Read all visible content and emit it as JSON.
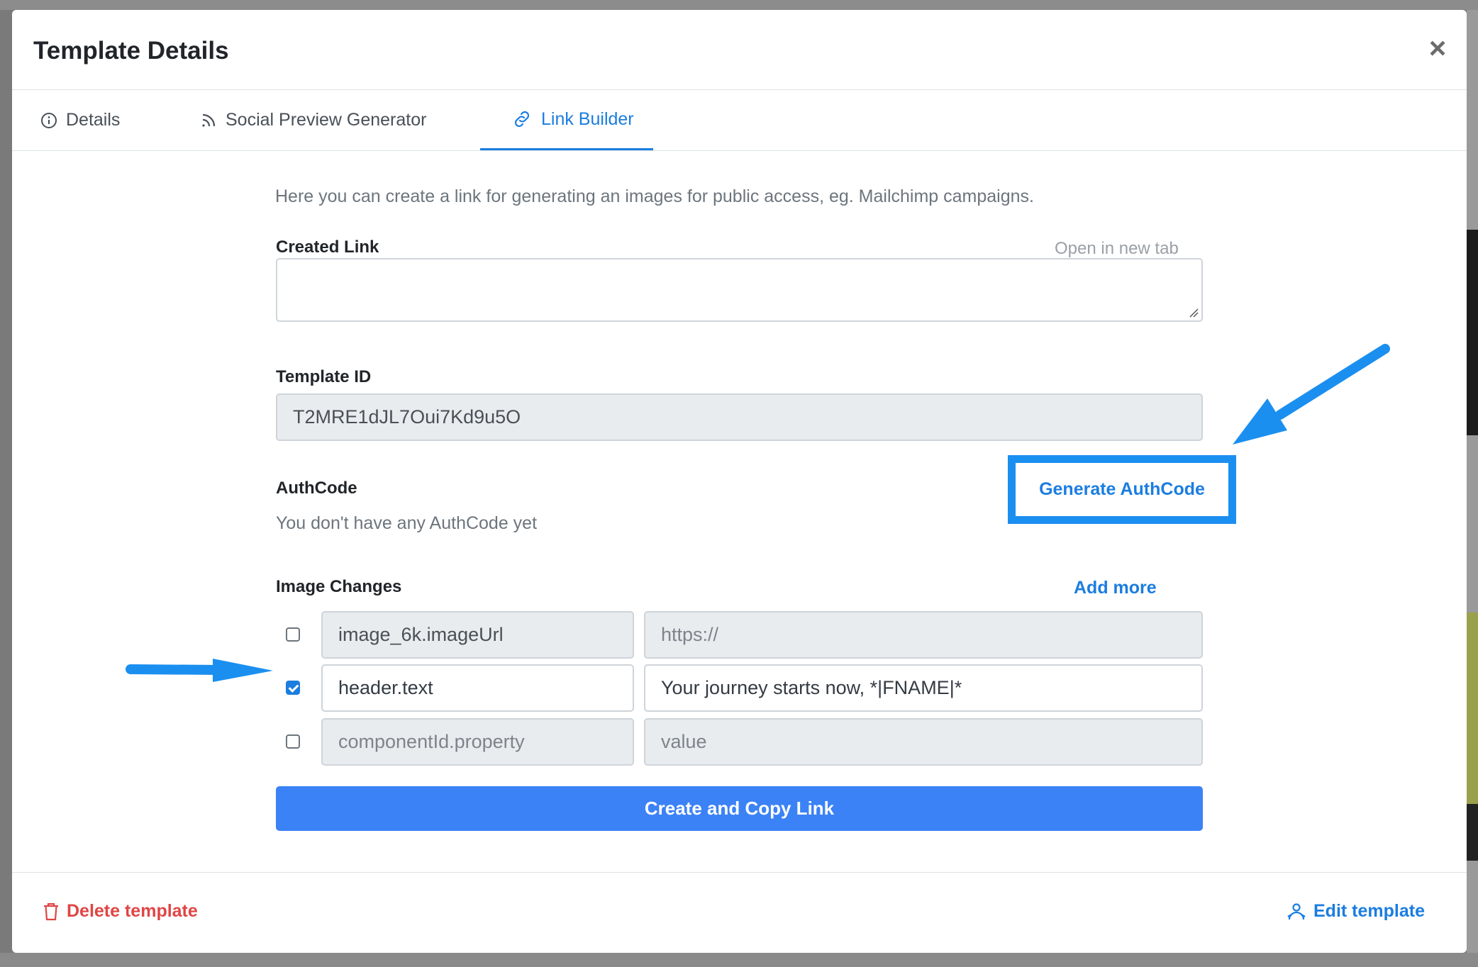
{
  "modal": {
    "title": "Template Details",
    "close_symbol": "×"
  },
  "tabs": [
    {
      "label": "Details",
      "icon": "info-icon"
    },
    {
      "label": "Social Preview Generator",
      "icon": "rss-icon"
    },
    {
      "label": "Link Builder",
      "icon": "link-icon",
      "active": true
    }
  ],
  "link_builder": {
    "intro": "Here you can create a link for generating an images for public access, eg. Mailchimp campaigns.",
    "created_link": {
      "label": "Created Link",
      "open_new_tab": "Open in new tab",
      "value": ""
    },
    "template_id": {
      "label": "Template ID",
      "value": "T2MRE1dJL7Oui7Kd9u5O"
    },
    "authcode": {
      "label": "AuthCode",
      "empty_text": "You don't have any AuthCode yet",
      "generate_label": "Generate AuthCode"
    },
    "image_changes": {
      "label": "Image Changes",
      "add_more": "Add more",
      "rows": [
        {
          "checked": false,
          "key": "image_6k.imageUrl",
          "value": "https://"
        },
        {
          "checked": true,
          "key": "header.text",
          "value": "Your journey starts now, *|FNAME|*"
        },
        {
          "checked": false,
          "key": "componentId.property",
          "value": "value"
        }
      ]
    },
    "create_button": "Create and Copy Link"
  },
  "footer": {
    "delete_label": "Delete template",
    "edit_label": "Edit template"
  },
  "colors": {
    "accent": "#1b7de0",
    "primary_button": "#3b82f6",
    "danger": "#e04545",
    "annotation_arrow": "#1b8ff0"
  }
}
